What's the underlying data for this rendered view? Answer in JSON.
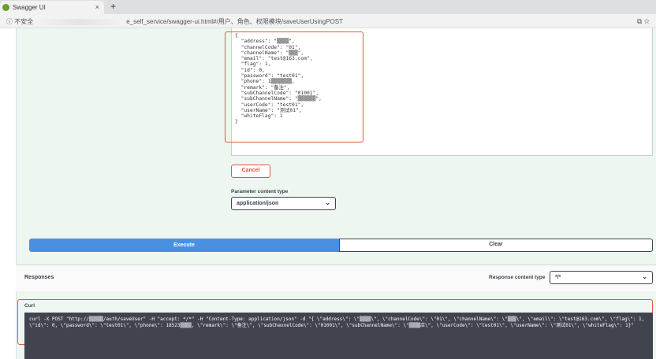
{
  "browser": {
    "tab_title": "Swagger UI",
    "new_tab": "+",
    "close": "×",
    "security": "ⓘ 不安全",
    "url": "e_self_service/swagger-ui.html#/用户、角色、权限模块/saveUserUsingPOST",
    "icons": [
      "translate-icon",
      "star-icon"
    ]
  },
  "body_json": "{\n  \"address\": \"▒▒▒▒\",\n  \"channelCode\": \"01\",\n  \"channelName\": \"▒▒▒\",\n  \"email\": \"test@163.com\",\n  \"flag\": 1,\n  \"id\": 0,\n  \"password\": \"test01\",\n  \"phone\": 1▒▒▒▒▒▒▒,\n  \"remark\": \"备注\",\n  \"subChannelCode\": \"01001\",\n  \"subChannelName\": \"▒▒▒▒▒▒\",\n  \"userCode\": \"test01\",\n  \"userName\": \"测试01\",\n  \"whiteFlag\": 1\n}",
  "cancel_label": "Cancel",
  "param_content_type": {
    "label": "Parameter content type",
    "value": "application/json"
  },
  "execute_label": "Execute",
  "clear_label": "Clear",
  "responses": {
    "label": "Responses",
    "content_type_label": "Response content type",
    "content_type_value": "*/*"
  },
  "curl": {
    "label": "Curl",
    "command": "curl -X POST \"http://▒▒▒▒▒/auth/saveUser\" -H \"accept: */*\" -H \"Content-Type: application/json\" -d \"{ \\\"address\\\": \\\"▒▒▒▒\\\", \\\"channelCode\\\": \\\"01\\\", \\\"channelName\\\": \\\"▒▒▒\\\", \\\"email\\\": \\\"test@163.com\\\", \\\"flag\\\": 1, \\\"id\\\": 0, \\\"password\\\": \\\"test01\\\", \\\"phone\\\": 18523▒▒▒▒, \\\"remark\\\": \\\"备注\\\", \\\"subChannelCode\\\": \\\"01001\\\", \\\"subChannelName\\\": \\\"▒▒▒▒店\\\", \\\"userCode\\\": \\\"test01\\\", \\\"userName\\\": \\\"测试01\\\", \\\"whiteFlag\\\": 1}\""
  },
  "colors": {
    "execute": "#4990e2",
    "highlight": "#e2563b",
    "curl_bg": "#41444e"
  }
}
